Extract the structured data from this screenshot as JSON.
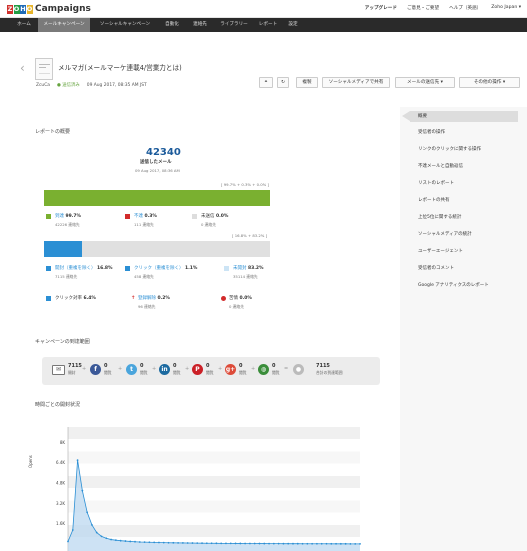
{
  "topbar": {
    "logo_letters": [
      "Z",
      "O",
      "H",
      "O"
    ],
    "logo_colors": [
      "#d0312d",
      "#239d44",
      "#1f6bb7",
      "#e8b52b"
    ],
    "brand": "Campaigns",
    "links": [
      "アップグレード",
      "ご意見・ご要望",
      "ヘルプ（英語）",
      "Zoho Japan ▾"
    ]
  },
  "nav": [
    "ホーム",
    "メールキャンペーン",
    "ソーシャルキャンペーン",
    "自動化",
    "連絡先",
    "ライブラリー",
    "レポート",
    "設定"
  ],
  "header": {
    "title": "メルマガ(メールマーケ連載4/営業力とは)",
    "author": "ZcuCa",
    "status": "送信済み",
    "sent_date": "09 Aug 2017, 08:35 AM JST",
    "buttons": [
      "複製",
      "ソーシャルメディアで共有",
      "メールの送信先 ▾",
      "その他の操作 ▾"
    ]
  },
  "overview": {
    "title": "レポートの概要",
    "total": "42340",
    "total_label": "送信したメール",
    "total_date": "09 Aug 2017, 08:36 AM",
    "bar1_label": "[ 99.7% + 0.3% + 0.0% ]",
    "bar2_label": "[ 16.8% + 83.2% ]",
    "row1": [
      {
        "name": "到達",
        "pct": "99.7%",
        "sub": "42226 連絡先",
        "color": "#7ab030"
      },
      {
        "name": "不達",
        "pct": "0.3%",
        "sub": "111 連絡先",
        "color": "#d22b2b"
      },
      {
        "name": "未送信",
        "pct": "0.0%",
        "sub": "0 連絡先",
        "color": "#ddd"
      }
    ],
    "row2": [
      {
        "name": "開封（重複を除く）",
        "pct": "16.8%",
        "sub": "7115 連絡先",
        "color": "#2b8fd4"
      },
      {
        "name": "クリック（重複を除く）",
        "pct": "1.1%",
        "sub": "458 連絡先",
        "color": "#2b8fd4"
      },
      {
        "name": "未開封",
        "pct": "83.2%",
        "sub": "35114 連絡先",
        "color": "#cce4f5"
      }
    ],
    "row3": [
      {
        "name": "クリック対率",
        "pct": "6.4%",
        "sub": "",
        "color": "#2b8fd4"
      },
      {
        "name": "登録解除",
        "pct": "0.2%",
        "sub": "96 連絡先",
        "color": "#d22b2b"
      },
      {
        "name": "苦情",
        "pct": "0.0%",
        "sub": "0 連絡先",
        "color": "#d22b2b"
      }
    ]
  },
  "reach": {
    "title": "キャンペーンの到達範囲",
    "items": [
      {
        "icon": "mail-icon",
        "num": "7115",
        "sub": "開封"
      },
      {
        "icon": "facebook-icon",
        "num": "0",
        "sub": "閲覧"
      },
      {
        "icon": "twitter-icon",
        "num": "0",
        "sub": "閲覧"
      },
      {
        "icon": "linkedin-icon",
        "num": "0",
        "sub": "閲覧"
      },
      {
        "icon": "pinterest-icon",
        "num": "0",
        "sub": "閲覧"
      },
      {
        "icon": "googleplus-icon",
        "num": "0",
        "sub": "閲覧"
      },
      {
        "icon": "globe-icon",
        "num": "0",
        "sub": "閲覧"
      },
      {
        "icon": "people-icon",
        "num": "7115",
        "sub": "合計の到達範囲"
      }
    ]
  },
  "opens_chart": {
    "title": "時間ごとの開封状況",
    "ylabel": "Opens"
  },
  "chart_data": {
    "type": "line",
    "ylim": [
      0,
      8000
    ],
    "yticks": [
      "8K",
      "6.4K",
      "4.8K",
      "3.2K",
      "1.6K"
    ],
    "values": [
      200,
      1100,
      6600,
      4200,
      2500,
      1500,
      900,
      600,
      450,
      350,
      300,
      260,
      230,
      200,
      180,
      160,
      150,
      140,
      130,
      120,
      110,
      100,
      95,
      90,
      85,
      80,
      75,
      70,
      65,
      60,
      58,
      55,
      52,
      50,
      48,
      46,
      44,
      42,
      40,
      38,
      36,
      34,
      32,
      30,
      28,
      26,
      25,
      24,
      23,
      22,
      21,
      20,
      19,
      18,
      17,
      16,
      15,
      14,
      13,
      12,
      11,
      10
    ]
  },
  "sidebar": [
    "概要",
    "受信者の操作",
    "リンクのクリックに関する操作",
    "不達メールと自動返信",
    "リストのレポート",
    "レポートの共有",
    "上位5位に関する統計",
    "ソーシャルメディアの統計",
    "ユーザーエージェント",
    "受信者のコメント",
    "Google アナリティクスのレポート"
  ]
}
